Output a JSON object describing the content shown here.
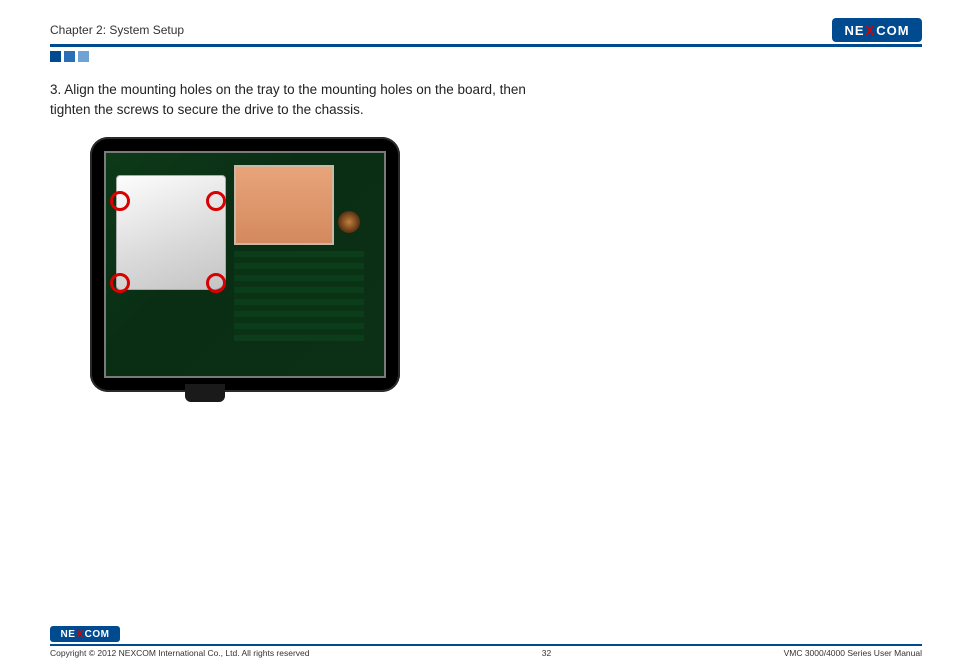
{
  "header": {
    "chapter": "Chapter 2: System Setup",
    "logo_text_left": "NE",
    "logo_text_x": "X",
    "logo_text_right": "COM"
  },
  "body": {
    "step_number": "3.",
    "step_text": "Align the mounting holes on the tray to the mounting holes on the board, then tighten the screws to secure the drive to the chassis."
  },
  "footer": {
    "logo_text_left": "NE",
    "logo_text_x": "X",
    "logo_text_right": "COM",
    "copyright": "Copyright © 2012 NEXCOM International Co., Ltd. All rights reserved",
    "page_number": "32",
    "manual_title": "VMC 3000/4000 Series User Manual"
  }
}
